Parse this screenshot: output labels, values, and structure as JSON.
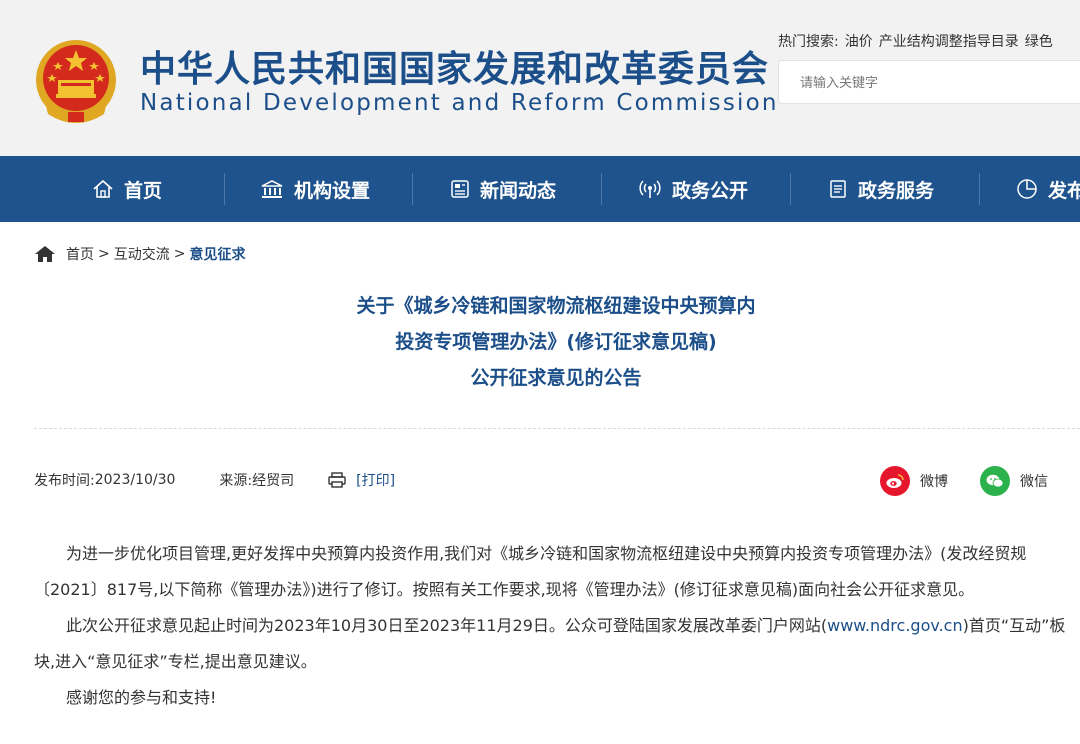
{
  "header": {
    "title_cn": "中华人民共和国国家发展和改革委员会",
    "title_en": "National Development and Reform Commission",
    "hot_search_label": "热门搜索:",
    "hot_keywords": [
      "油价",
      "产业结构调整指导目录",
      "绿色"
    ],
    "search_placeholder": "请输入关键字"
  },
  "nav": {
    "items": [
      {
        "label": "首页",
        "icon": "home-icon"
      },
      {
        "label": "机构设置",
        "icon": "building-icon"
      },
      {
        "label": "新闻动态",
        "icon": "news-icon"
      },
      {
        "label": "政务公开",
        "icon": "broadcast-icon"
      },
      {
        "label": "政务服务",
        "icon": "document-icon"
      },
      {
        "label": "发布",
        "icon": "pie-chart-icon"
      }
    ]
  },
  "breadcrumb": {
    "items": [
      "首页",
      "互动交流",
      "意见征求"
    ],
    "separator": ">"
  },
  "article": {
    "title_lines": [
      "关于《城乡冷链和国家物流枢纽建设中央预算内",
      "投资专项管理办法》(修订征求意见稿)",
      "公开征求意见的公告"
    ],
    "publish_label": "发布时间:",
    "publish_date": "2023/10/30",
    "source_label": "来源:",
    "source": "经贸司",
    "print_label": "[打印]",
    "share_weibo": "微博",
    "share_wechat": "微信",
    "para1": "为进一步优化项目管理,更好发挥中央预算内投资作用,我们对《城乡冷链和国家物流枢纽建设中央预算内投资专项管理办法》(发改经贸规〔2021〕817号,以下简称《管理办法》)进行了修订。按照有关工作要求,现将《管理办法》(修订征求意见稿)面向社会公开征求意见。",
    "para2_a": "此次公开征求意见起止时间为2023年10月30日至2023年11月29日。公众可登陆国家发展改革委门户网站(",
    "para2_link": "www.ndrc.gov.cn",
    "para2_b": ")首页“互动”板块,进入“意见征求”专栏,提出意见建议。",
    "para3": "感谢您的参与和支持!"
  },
  "colors": {
    "brand_blue": "#1c4f8a",
    "nav_bg": "#1e538d",
    "emblem_red": "#d42a1e",
    "emblem_gold": "#f2c230",
    "weibo_red": "#e6162d",
    "wechat_green": "#2bb24c"
  }
}
